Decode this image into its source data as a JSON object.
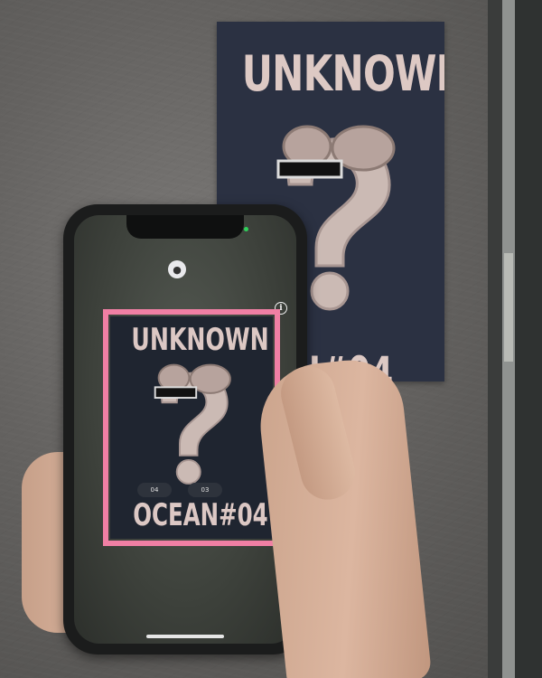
{
  "wall_poster": {
    "title": "UNKNOWN",
    "footer": "AN#04"
  },
  "phone": {
    "status_icon": "lock-icon",
    "info_icon": "info-icon",
    "scan_frame_color": "#f07fa4",
    "screen_poster": {
      "title": "UNKNOWN",
      "footer": "OCEAN#04",
      "tags": [
        "04",
        "03"
      ]
    }
  }
}
